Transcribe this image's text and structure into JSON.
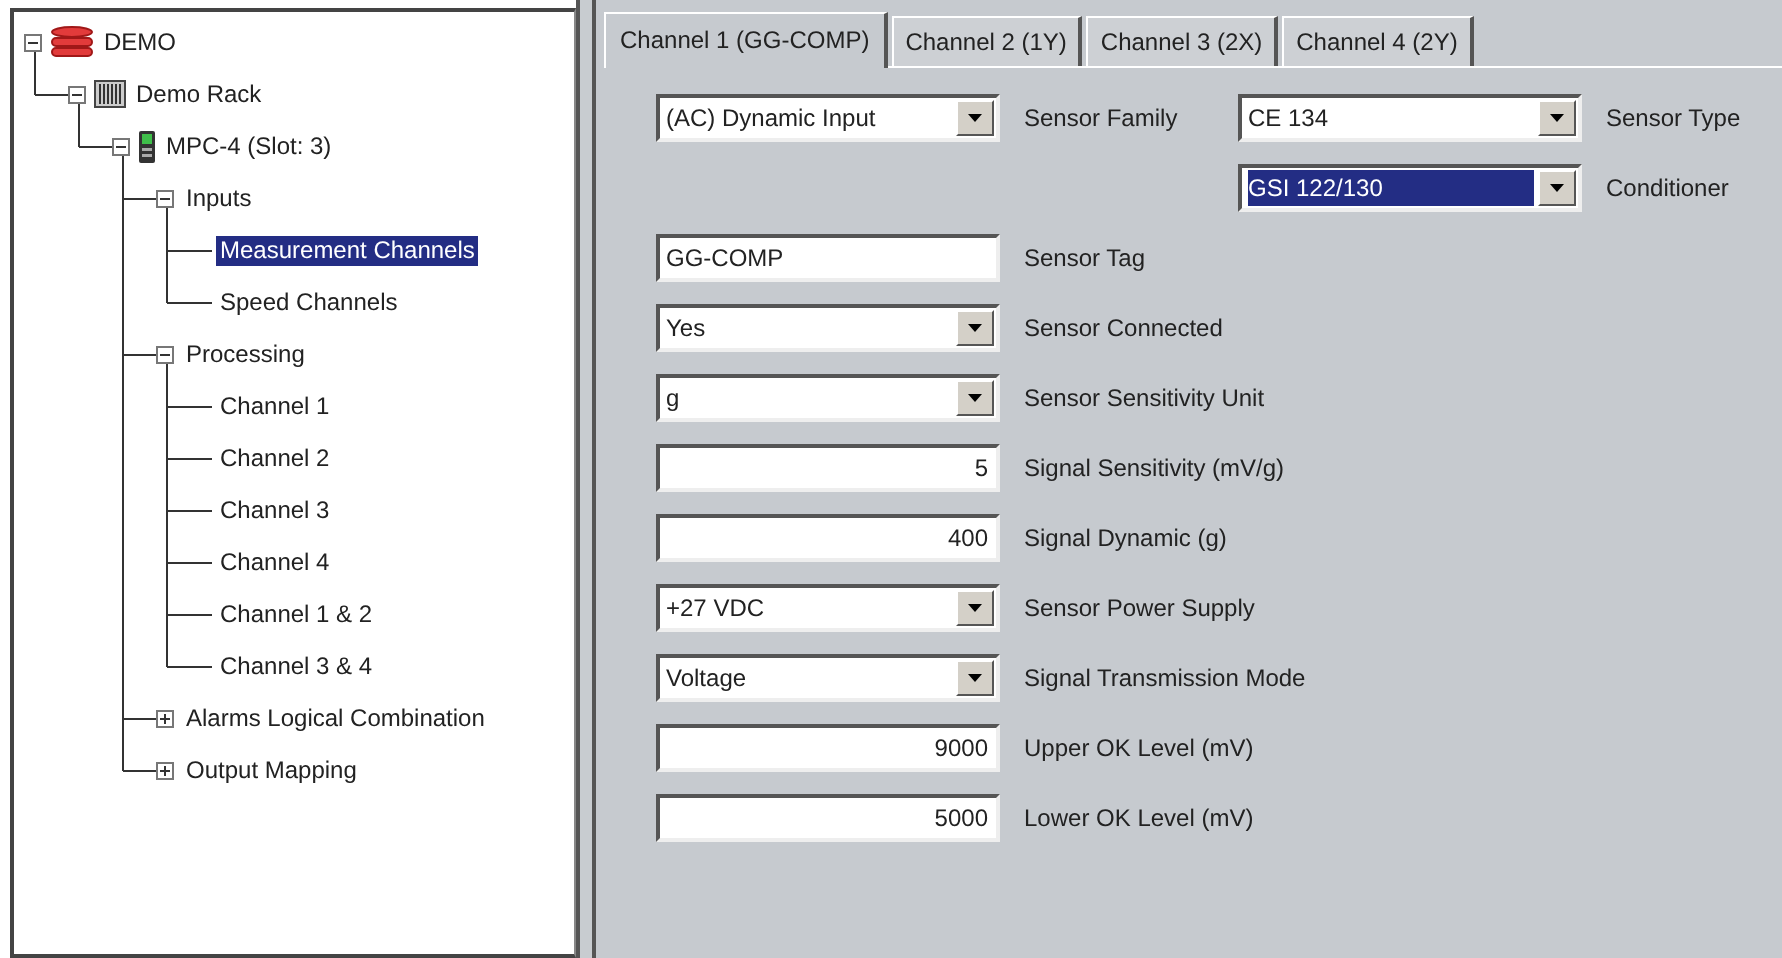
{
  "tree": [
    {
      "label": "DEMO",
      "kind": "database",
      "expanded": true,
      "selected": false,
      "children": [
        {
          "label": "Demo Rack",
          "kind": "rack",
          "expanded": true,
          "selected": false,
          "children": [
            {
              "label": "MPC-4 (Slot: 3)",
              "kind": "module",
              "expanded": true,
              "selected": false,
              "children": [
                {
                  "label": "Inputs",
                  "expanded": true,
                  "selected": false,
                  "children": [
                    {
                      "label": "Measurement Channels",
                      "selected": true
                    },
                    {
                      "label": "Speed Channels",
                      "selected": false
                    }
                  ]
                },
                {
                  "label": "Processing",
                  "expanded": true,
                  "selected": false,
                  "children": [
                    {
                      "label": "Channel 1",
                      "selected": false
                    },
                    {
                      "label": "Channel 2",
                      "selected": false
                    },
                    {
                      "label": "Channel 3",
                      "selected": false
                    },
                    {
                      "label": "Channel 4",
                      "selected": false
                    },
                    {
                      "label": "Channel 1 & 2",
                      "selected": false
                    },
                    {
                      "label": "Channel 3 & 4",
                      "selected": false
                    }
                  ]
                },
                {
                  "label": "Alarms Logical Combination",
                  "expanded": false,
                  "selected": false
                },
                {
                  "label": "Output Mapping",
                  "expanded": false,
                  "selected": false
                }
              ]
            }
          ]
        }
      ]
    }
  ],
  "tabs": [
    {
      "label": "Channel 1 (GG-COMP)",
      "selected": true
    },
    {
      "label": "Channel 2 (1Y)",
      "selected": false
    },
    {
      "label": "Channel 3 (2X)",
      "selected": false
    },
    {
      "label": "Channel 4 (2Y)",
      "selected": false
    }
  ],
  "form": [
    {
      "left": {
        "kind": "dropdown",
        "value": "(AC) Dynamic Input",
        "label": "Sensor Family",
        "selected": false
      },
      "right": {
        "kind": "dropdown",
        "value": "CE 134",
        "label": "Sensor Type",
        "selected": false
      }
    },
    {
      "right": {
        "kind": "dropdown",
        "value": "GSI 122/130",
        "label": "Conditioner",
        "selected": true
      }
    },
    {
      "left": {
        "kind": "text",
        "value": "GG-COMP",
        "label": "Sensor Tag",
        "selected": false
      }
    },
    {
      "left": {
        "kind": "dropdown",
        "value": "Yes",
        "label": "Sensor Connected",
        "selected": false
      }
    },
    {
      "left": {
        "kind": "dropdown",
        "value": "g",
        "label": "Sensor Sensitivity Unit",
        "selected": false
      }
    },
    {
      "left": {
        "kind": "number",
        "value": "5",
        "label": "Signal Sensitivity (mV/g)",
        "selected": false
      }
    },
    {
      "left": {
        "kind": "number",
        "value": "400",
        "label": "Signal Dynamic (g)",
        "selected": false
      }
    },
    {
      "left": {
        "kind": "dropdown",
        "value": "+27 VDC",
        "label": "Sensor Power Supply",
        "selected": false
      }
    },
    {
      "left": {
        "kind": "dropdown",
        "value": "Voltage",
        "label": "Signal Transmission Mode",
        "selected": false
      }
    },
    {
      "left": {
        "kind": "number",
        "value": "9000",
        "label": "Upper OK Level (mV)",
        "selected": false
      }
    },
    {
      "left": {
        "kind": "number",
        "value": "5000",
        "label": "Lower OK Level (mV)",
        "selected": false
      }
    }
  ]
}
